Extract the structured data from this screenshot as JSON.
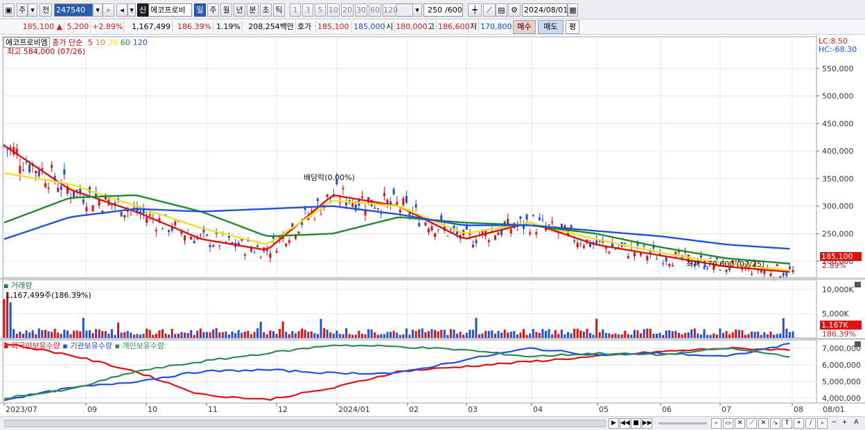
{
  "toolbar": {
    "market": "주",
    "prev": "전",
    "code": "247540",
    "credit_badge": "신",
    "stock_name": "에코프로비",
    "periods": [
      "일",
      "주",
      "월",
      "년",
      "분",
      "초",
      "틱"
    ],
    "active_period": "일",
    "intervals": [
      "1",
      "3",
      "5",
      "10",
      "20",
      "30",
      "60",
      "120"
    ],
    "count": "250",
    "count_max": "/600",
    "date": "2024/08/01"
  },
  "quote": {
    "price": "185,100",
    "arrow": "▲",
    "change": "5,200",
    "change_pct": "+2.89%",
    "volume": "1,167,499",
    "volume_ratio": "186.39%",
    "turnover": "1.19%",
    "amount": "208,254백만",
    "bid_label": "호가",
    "bid1": "185,100",
    "bid2": "185,000",
    "open_label": "시",
    "open": "180,000",
    "high_label": "고",
    "high": "186,600",
    "low_label": "저",
    "low": "170,800",
    "buy_label": "매수",
    "sell_label": "매도",
    "eval_label": "평"
  },
  "price_pane": {
    "legend_name": "에코프로비엠",
    "legend_kind": "종가 단순",
    "ma_labels": [
      "5",
      "10",
      "20",
      "60",
      "120"
    ],
    "ma_colors": [
      "#e01010",
      "#f08020",
      "#f2e020",
      "#1f8a2a",
      "#2050e0"
    ],
    "high_note": "최고 584,000 (07/26)",
    "low_note": "최저 170,600 (07/25)",
    "dividend_note": "배당락(0.00%)",
    "lc": "LC:8.50",
    "hc": "HC:-68.30",
    "price_tag": "185,100",
    "price_tag_pct": "2.89%"
  },
  "volume_pane": {
    "title": "거래량",
    "current": "1,167,499주(186.39%)",
    "tag": "1,167K",
    "tag_pct": "186.39%"
  },
  "holdings_pane": {
    "series_labels": [
      "외국인보유수량",
      "기관보유수량",
      "개인보유수량"
    ]
  },
  "chart_data": [
    {
      "type": "line",
      "title": "",
      "x": [
        "2023/07",
        "09",
        "10",
        "11",
        "12",
        "2024/01",
        "02",
        "03",
        "04",
        "05",
        "06",
        "07",
        "08"
      ],
      "ylim": [
        170000,
        600000
      ],
      "y_ticks": [
        "550,000",
        "500,000",
        "450,000",
        "400,000",
        "350,000",
        "300,000",
        "250,000",
        "200,000"
      ],
      "series": [
        {
          "name": "5",
          "color": "#e01010",
          "values": [
            410000,
            330000,
            290000,
            240000,
            220000,
            320000,
            300000,
            240000,
            270000,
            230000,
            210000,
            190000,
            180000
          ]
        },
        {
          "name": "20",
          "color": "#f2e020",
          "values": [
            360000,
            340000,
            300000,
            260000,
            230000,
            310000,
            300000,
            250000,
            270000,
            240000,
            215000,
            195000,
            183000
          ]
        },
        {
          "name": "60",
          "color": "#1f8a2a",
          "values": [
            270000,
            315000,
            320000,
            290000,
            245000,
            250000,
            280000,
            270000,
            265000,
            250000,
            225000,
            205000,
            195000
          ]
        },
        {
          "name": "120",
          "color": "#2050e0",
          "values": [
            240000,
            280000,
            295000,
            290000,
            295000,
            300000,
            285000,
            265000,
            265000,
            255000,
            245000,
            230000,
            222000
          ]
        }
      ]
    },
    {
      "type": "bar",
      "title": "거래량",
      "y_ticks": [
        "10,000K",
        "5,000K"
      ],
      "ylim": [
        0,
        12000000
      ]
    },
    {
      "type": "line",
      "title": "",
      "y_ticks": [
        "7,000,000",
        "6,000,000",
        "5,000,000",
        "4,000,000"
      ],
      "ylim": [
        3700000,
        7500000
      ],
      "series": [
        {
          "name": "외국인보유수량",
          "color": "#e01010",
          "values": [
            7300000,
            6600000,
            5600000,
            4200000,
            3900000,
            4600000,
            5600000,
            5900000,
            6200000,
            6500000,
            6800000,
            7000000,
            6900000
          ]
        },
        {
          "name": "기관보유수량",
          "color": "#2050e0",
          "values": [
            3900000,
            4600000,
            5000000,
            5600000,
            5700000,
            5500000,
            5500000,
            6300000,
            7000000,
            6600000,
            6700000,
            6500000,
            7300000
          ]
        },
        {
          "name": "개인보유수량",
          "color": "#2e8b57",
          "values": [
            4000000,
            4500000,
            5600000,
            6200000,
            6700000,
            7200000,
            7100000,
            6900000,
            6500000,
            6700000,
            6600000,
            7000000,
            6500000
          ]
        }
      ]
    }
  ]
}
